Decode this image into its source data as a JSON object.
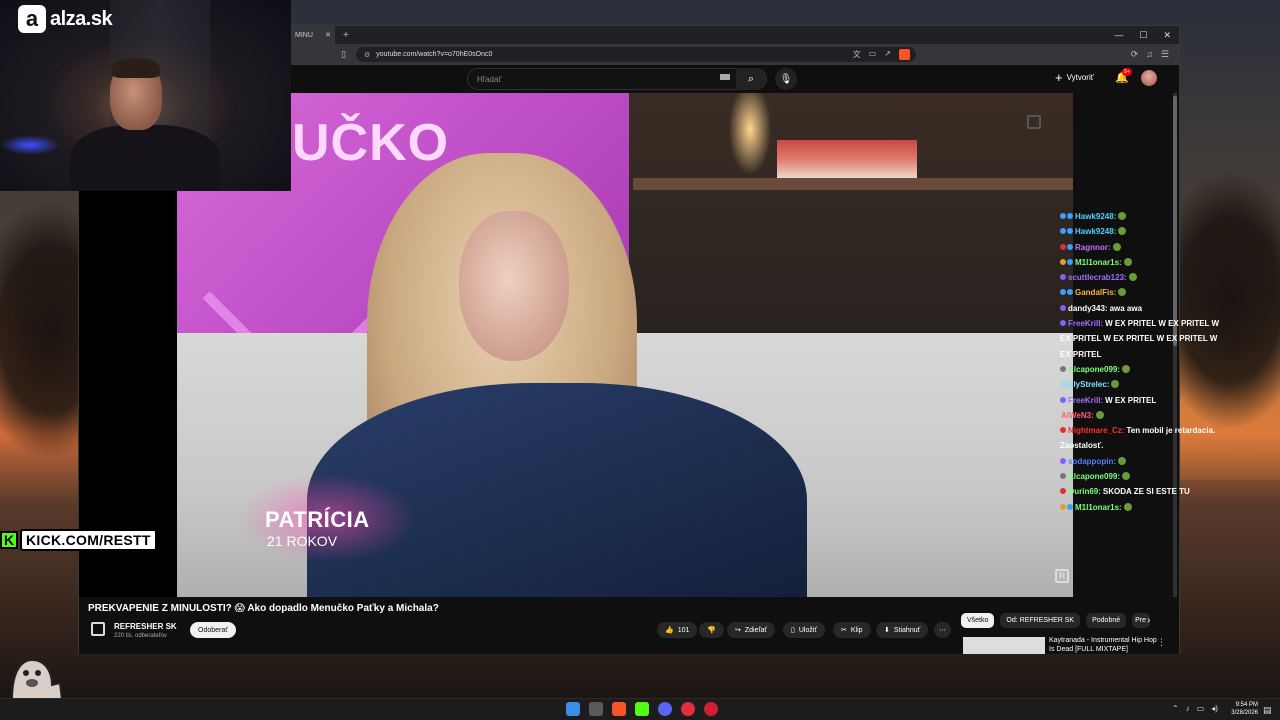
{
  "overlay": {
    "alza_logo": "alza.sk",
    "kick_k": "K",
    "kick_link": "KICK.COM/RESTT"
  },
  "browser": {
    "tab_title": "MINU",
    "url": "youtube.com/watch?v=o70hE0sOnc0"
  },
  "youtube": {
    "search_placeholder": "Hľadať",
    "create_label": "Vytvoriť",
    "notif_badge": "9+",
    "video_lower_name": "PATRÍCIA",
    "video_lower_age": "21 ROKOV",
    "video_bg_title": "UČKO",
    "video_title": "PREKVAPENIE Z MINULOSTI? 😱 Ako dopadlo Menučko Paťky a Michala?",
    "channel_name": "REFRESHER SK",
    "channel_subs": "220 tis. odberateľov",
    "subscribe_label": "Odoberať",
    "like_count": "101",
    "share_label": "Zdieľať",
    "save_label": "Uložiť",
    "clip_label": "Klip",
    "download_label": "Stiahnuť",
    "more_label": "⋯",
    "chips": [
      "Všetko",
      "Od: REFRESHER SK",
      "Podobné",
      "Pre"
    ],
    "rec_title": "Kaytranada - Instrumental Hip Hop Is Dead [FULL MIXTAPE]"
  },
  "chat": [
    {
      "user": "Hawk9248:",
      "color": "#4fd0ff",
      "badges": [
        "#39a0ff",
        "#39a0ff"
      ],
      "msg": "",
      "emote": true
    },
    {
      "user": "Hawk9248:",
      "color": "#4fd0ff",
      "badges": [
        "#39a0ff",
        "#39a0ff"
      ],
      "msg": "",
      "emote": true
    },
    {
      "user": "Ragnnor:",
      "color": "#c070ff",
      "badges": [
        "#e03030",
        "#39a0ff"
      ],
      "msg": "",
      "emote": true
    },
    {
      "user": "M1l1onar1s:",
      "color": "#7dff7d",
      "badges": [
        "#e0a030",
        "#39a0ff"
      ],
      "msg": "",
      "emote": true
    },
    {
      "user": "scuttlecrab123:",
      "color": "#a070ff",
      "badges": [
        "#8060ff"
      ],
      "msg": "",
      "emote": true
    },
    {
      "user": "GandalFis:",
      "color": "#ffb040",
      "badges": [
        "#39a0ff",
        "#39a0ff"
      ],
      "msg": "",
      "emote": true
    },
    {
      "user": "dandy343:",
      "color": "#ffffff",
      "badges": [
        "#8060ff"
      ],
      "msg": "awa awa",
      "emote": false
    },
    {
      "user": "FreeKrill:",
      "color": "#a070ff",
      "badges": [
        "#8060ff"
      ],
      "msg": "W EX PRITEL W EX PRITEL W EX PRITEL W EX PRITEL W EX PRITEL W EX PRITEL",
      "emote": false
    },
    {
      "user": "Alcapone099:",
      "color": "#7dff7d",
      "badges": [
        "#777777"
      ],
      "msg": "",
      "emote": true
    },
    {
      "user": "BielyStrelec:",
      "color": "#7de0ff",
      "badges": [],
      "msg": "",
      "emote": true
    },
    {
      "user": "FreeKrill:",
      "color": "#a070ff",
      "badges": [
        "#8060ff"
      ],
      "msg": "W EX PRITEL",
      "emote": false
    },
    {
      "user": "AlWeN3:",
      "color": "#ff6080",
      "badges": [],
      "msg": "",
      "emote": true
    },
    {
      "user": "Nightmare_Cz:",
      "color": "#ff3030",
      "badges": [
        "#e03030"
      ],
      "msg": "Ten mobil je retardacia. Zaostalosť.",
      "emote": false
    },
    {
      "user": "sodappopin:",
      "color": "#5080ff",
      "badges": [
        "#8060ff"
      ],
      "msg": "",
      "emote": true
    },
    {
      "user": "Alcapone099:",
      "color": "#7dff7d",
      "badges": [
        "#777777"
      ],
      "msg": "",
      "emote": true
    },
    {
      "user": "Ourin69:",
      "color": "#7dff7d",
      "badges": [
        "#e03030"
      ],
      "msg": "SKODA ZE SI ESTE TU",
      "emote": false
    },
    {
      "user": "M1l1onar1s:",
      "color": "#7dff7d",
      "badges": [
        "#e0a030",
        "#39a0ff"
      ],
      "msg": "",
      "emote": true
    }
  ],
  "taskbar": {
    "time": "9:54 PM",
    "date": "3/28/2026"
  }
}
